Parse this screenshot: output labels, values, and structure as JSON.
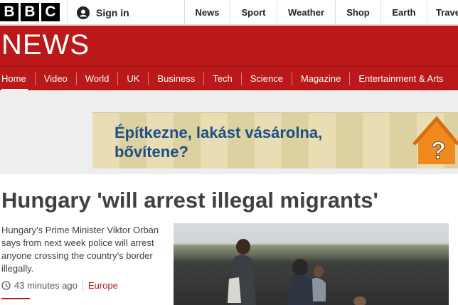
{
  "brand": {
    "letters": [
      "B",
      "B",
      "C"
    ]
  },
  "account": {
    "signin_label": "Sign in",
    "icon": "user-icon"
  },
  "top_nav": [
    {
      "label": "News"
    },
    {
      "label": "Sport"
    },
    {
      "label": "Weather"
    },
    {
      "label": "Shop"
    },
    {
      "label": "Earth"
    },
    {
      "label": "Trave"
    }
  ],
  "news_header": {
    "title": "NEWS"
  },
  "section_nav": [
    {
      "label": "Home",
      "active": true
    },
    {
      "label": "Video"
    },
    {
      "label": "World"
    },
    {
      "label": "UK"
    },
    {
      "label": "Business"
    },
    {
      "label": "Tech"
    },
    {
      "label": "Science"
    },
    {
      "label": "Magazine"
    },
    {
      "label": "Entertainment & Arts"
    }
  ],
  "advert": {
    "line1": "Építkezne, lakást vásárolna,",
    "line2": "bővítene?",
    "icon": "question-mark-house-icon"
  },
  "story": {
    "headline": "Hungary 'will arrest illegal migrants'",
    "summary": "Hungary's Prime Minister Viktor Orban says from next week police will arrest anyone crossing the country's border illegally.",
    "time": "43 minutes ago",
    "category": "Europe",
    "image_icon": "migrants-photo"
  },
  "colors": {
    "brand_red": "#bb1919",
    "text_dark": "#404040",
    "ad_blue": "#1d4f86"
  }
}
